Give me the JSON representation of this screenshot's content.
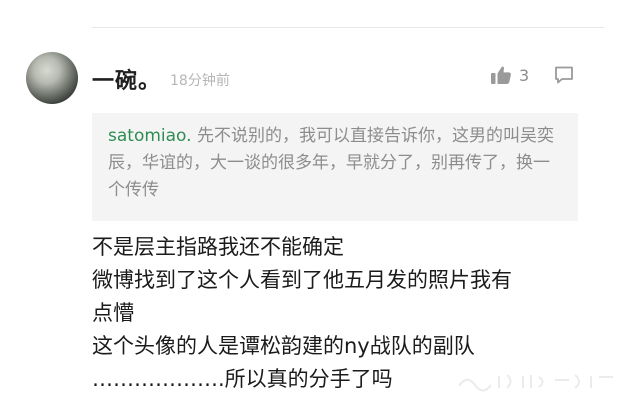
{
  "comment": {
    "username": "一碗。",
    "timestamp": "18分钟前",
    "likes": "3",
    "icons": {
      "like": "thumbs-up-icon",
      "reply": "comment-icon"
    }
  },
  "quote": {
    "user": "satomiao.",
    "text": " 先不说别的，我可以直接告诉你，这男的叫吴奕辰，华谊的，大一谈的很多年，早就分了，别再传了，换一个传传"
  },
  "reply": {
    "lines": [
      "不是层主指路我还不能确定",
      "微博找到了这个人看到了他五月发的照片我有",
      "点懵",
      "这个头像的人是谭松韵建的ny战队的副队",
      "……………….所以真的分手了吗"
    ]
  },
  "colors": {
    "quote_user": "#2f8d53",
    "body_text": "#1b1b1b",
    "muted_text": "#8d8d8d",
    "box_background": "#f4f4f4"
  }
}
